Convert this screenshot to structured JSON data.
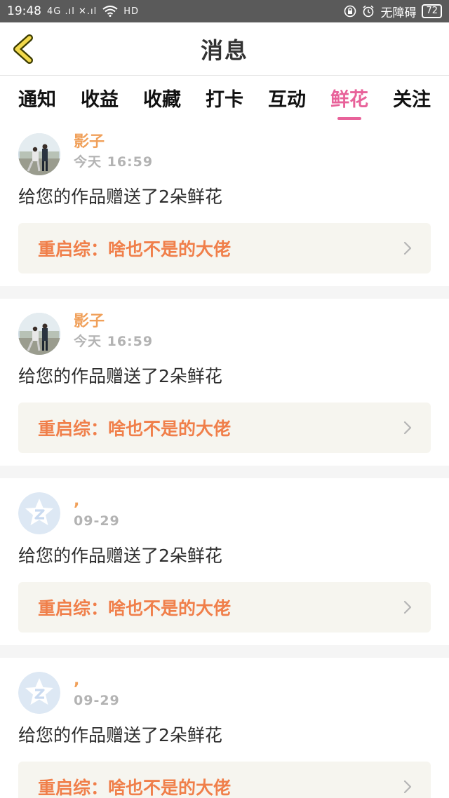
{
  "status_bar": {
    "time": "19:48",
    "signal_text": "4G .ıl ✕.ıl",
    "hd_text": "HD",
    "accessibility": "无障碍",
    "battery": "72"
  },
  "header": {
    "title": "消息",
    "back_icon": "chevron-left-icon"
  },
  "tabs": [
    {
      "label": "通知",
      "active": false
    },
    {
      "label": "收益",
      "active": false
    },
    {
      "label": "收藏",
      "active": false
    },
    {
      "label": "打卡",
      "active": false
    },
    {
      "label": "互动",
      "active": false
    },
    {
      "label": "鲜花",
      "active": true
    },
    {
      "label": "关注",
      "active": false
    }
  ],
  "colors": {
    "accent_pink": "#e8629a",
    "username_orange": "#f0a05a",
    "link_orange": "#f07f4a",
    "link_bg": "#f6f5ef"
  },
  "notifications": [
    {
      "avatar": "photo-avatar",
      "username": "影子",
      "time": "今天  16:59",
      "message": "给您的作品赠送了2朵鲜花",
      "work_title": "重启综：啥也不是的大佬"
    },
    {
      "avatar": "photo-avatar",
      "username": "影子",
      "time": "今天  16:59",
      "message": "给您的作品赠送了2朵鲜花",
      "work_title": "重启综：啥也不是的大佬"
    },
    {
      "avatar": "qq-default-avatar",
      "username": ",",
      "time": "09-29",
      "message": "给您的作品赠送了2朵鲜花",
      "work_title": "重启综：啥也不是的大佬"
    },
    {
      "avatar": "qq-default-avatar",
      "username": ",",
      "time": "09-29",
      "message": "给您的作品赠送了2朵鲜花",
      "work_title": "重启综：啥也不是的大佬"
    }
  ]
}
